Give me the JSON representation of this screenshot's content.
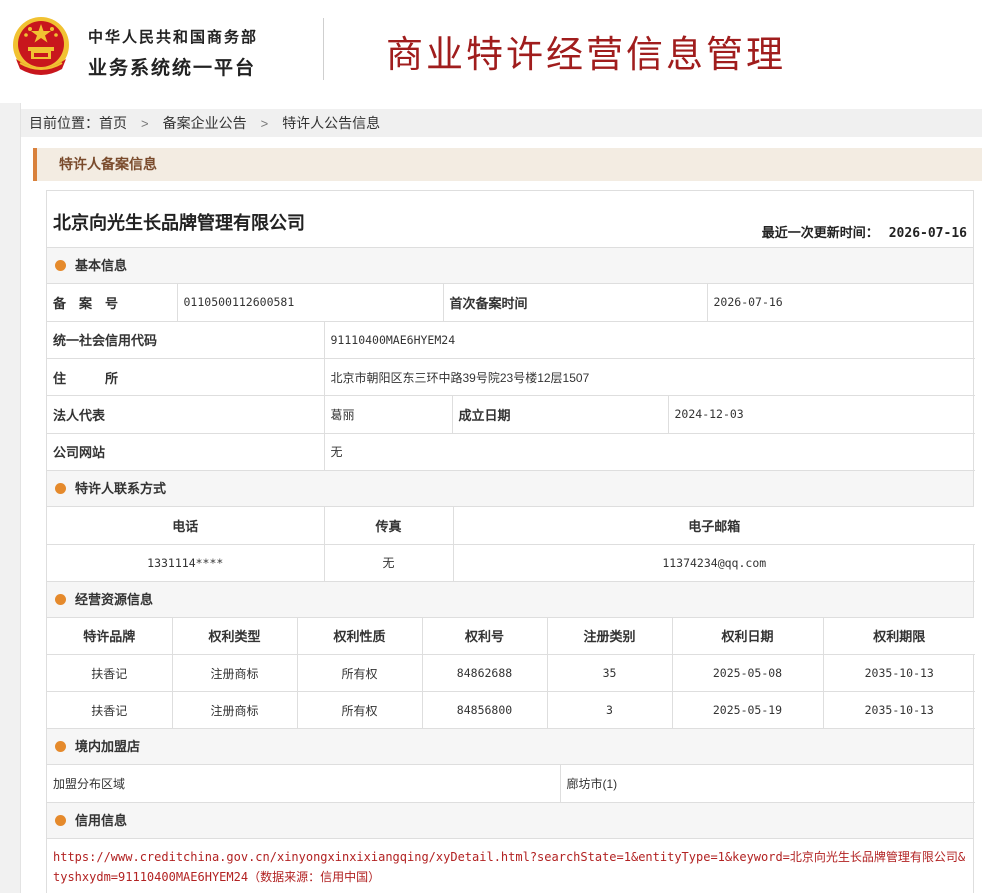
{
  "header": {
    "org_line1": "中华人民共和国商务部",
    "org_line2": "业务系统统一平台",
    "site_title": "商业特许经营信息管理",
    "emblem_colors": {
      "red": "#c8161d",
      "gold": "#f1c232"
    }
  },
  "breadcrumb": {
    "prefix": "目前位置：",
    "items": [
      "首页",
      "备案企业公告",
      "特许人公告信息"
    ],
    "separator": ">"
  },
  "section_tab": "特许人备案信息",
  "company": {
    "name": "北京向光生长品牌管理有限公司",
    "update_label": "最近一次更新时间：",
    "update_value": "2026-07-16"
  },
  "basic": {
    "title": "基本信息",
    "record_no_label": "备　案　号",
    "record_no": "0110500112600581",
    "first_record_label": "首次备案时间",
    "first_record": "2026-07-16",
    "credit_code_label": "统一社会信用代码",
    "credit_code": "91110400MAE6HYEM24",
    "address_label": "住　　　所",
    "address": "北京市朝阳区东三环中路39号院23号楼12层1507",
    "legal_rep_label": "法人代表",
    "legal_rep": "葛丽",
    "founded_label": "成立日期",
    "founded": "2024-12-03",
    "website_label": "公司网站",
    "website": "无"
  },
  "contact": {
    "title": "特许人联系方式",
    "headers": [
      "电话",
      "传真",
      "电子邮箱"
    ],
    "phone": "1331114****",
    "fax": "无",
    "email": "11374234@qq.com"
  },
  "resources": {
    "title": "经营资源信息",
    "headers": [
      "特许品牌",
      "权利类型",
      "权利性质",
      "权利号",
      "注册类别",
      "权利日期",
      "权利期限"
    ],
    "rows": [
      [
        "扶香记",
        "注册商标",
        "所有权",
        "84862688",
        "35",
        "2025-05-08",
        "2035-10-13"
      ],
      [
        "扶香记",
        "注册商标",
        "所有权",
        "84856800",
        "3",
        "2025-05-19",
        "2035-10-13"
      ]
    ]
  },
  "franchise": {
    "title": "境内加盟店",
    "area_label": "加盟分布区域",
    "area_value": "廊坊市(1)"
  },
  "credit": {
    "title": "信用信息",
    "url": "https://www.creditchina.gov.cn/xinyongxinxixiangqing/xyDetail.html?searchState=1&entityType=1&keyword=北京向光生长品牌管理有限公司&tyshxydm=91110400MAE6HYEM24",
    "source": "（数据来源：信用中国）"
  }
}
